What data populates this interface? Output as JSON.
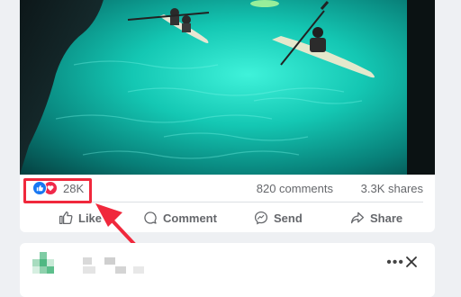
{
  "post": {
    "reactions": {
      "icons": [
        "like-reaction-icon",
        "love-reaction-icon"
      ],
      "count": "28K"
    },
    "comments_count": "820 comments",
    "shares_count": "3.3K shares",
    "actions": {
      "like": "Like",
      "comment": "Comment",
      "send": "Send",
      "share": "Share"
    }
  },
  "next_post": {
    "more_icon": "more-options-icon",
    "close_icon": "close-icon"
  },
  "colors": {
    "highlight": "#f0283c",
    "like_blue": "#1877f2",
    "love_red": "#f0284a",
    "water_glow": "#23e0c8"
  }
}
